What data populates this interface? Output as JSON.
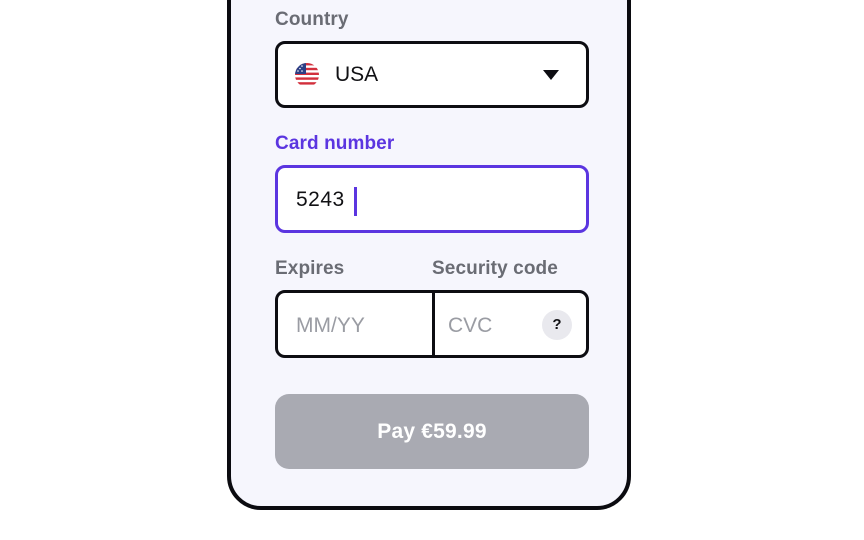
{
  "country": {
    "label": "Country",
    "value": "USA",
    "flag_icon": "us-flag-icon"
  },
  "card_number": {
    "label": "Card number",
    "value": "5243"
  },
  "expires": {
    "label": "Expires",
    "placeholder": "MM/YY"
  },
  "security_code": {
    "label": "Security code",
    "placeholder": "CVC",
    "help_icon_text": "?"
  },
  "pay_button": {
    "label": "Pay €59.99"
  },
  "colors": {
    "accent": "#5b35e0",
    "label_gray": "#6a6c74",
    "button_disabled": "#a9aab2",
    "panel_bg": "#f6f6fd",
    "border": "#0d0d12"
  }
}
